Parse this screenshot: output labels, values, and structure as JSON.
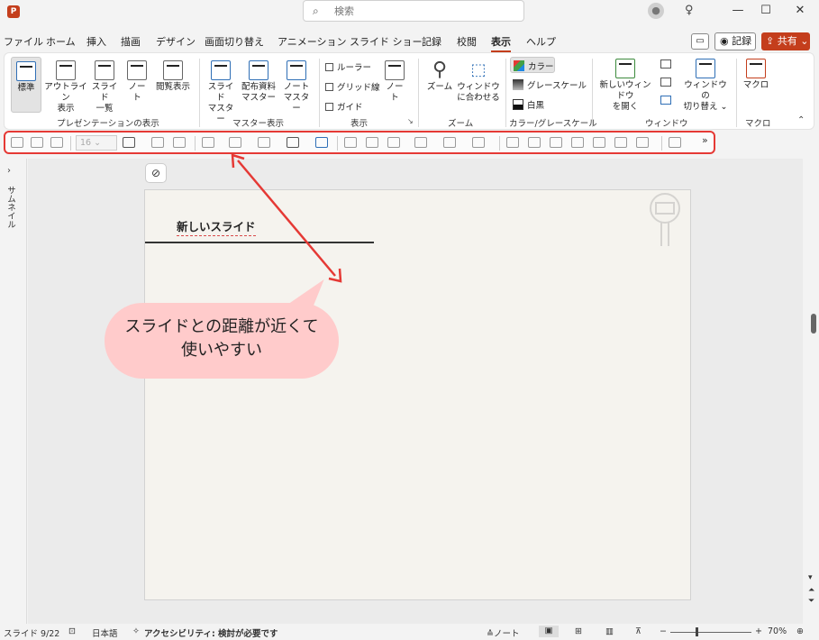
{
  "titlebar": {
    "app_icon": "P",
    "search_placeholder": "検索",
    "icons": [
      "user-icon",
      "lightbulb-icon",
      "minimize-icon",
      "maximize-icon",
      "close-icon"
    ],
    "min": "—",
    "max": "☐",
    "close": "✕"
  },
  "menu": {
    "tabs": [
      "ファイル",
      "ホーム",
      "挿入",
      "描画",
      "デザイン",
      "画面切り替え",
      "アニメーション",
      "スライド ショー",
      "記録",
      "校閲",
      "表示",
      "ヘルプ"
    ],
    "active_tab": "表示",
    "record_label": "記録",
    "share_label": "共有"
  },
  "ribbon": {
    "presentation_views": {
      "label": "プレゼンテーションの表示",
      "normal": "標準",
      "outline_1": "アウトライン",
      "outline_2": "表示",
      "sorter_1": "スライド",
      "sorter_2": "一覧",
      "notes_1": "ノー",
      "notes_2": "ト",
      "reading": "閲覧表示"
    },
    "master_views": {
      "label": "マスター表示",
      "slide_1": "スライド",
      "slide_2": "マスター",
      "handout_1": "配布資料",
      "handout_2": "マスター",
      "notes_1": "ノート",
      "notes_2": "マスター"
    },
    "show": {
      "label": "表示",
      "ruler": "ルーラー",
      "grid": "グリッド線",
      "guide": "ガイド",
      "notes_1": "ノー",
      "notes_2": "ト"
    },
    "zoom": {
      "label": "ズーム",
      "zoom": "ズーム",
      "fit_1": "ウィンドウ",
      "fit_2": "に合わせる"
    },
    "color": {
      "label": "カラー/グレースケール",
      "color": "カラー",
      "grayscale": "グレースケール",
      "bw": "白黒"
    },
    "window": {
      "label": "ウィンドウ",
      "new_1": "新しいウィンドウ",
      "new_2": "を開く",
      "switch_1": "ウィンドウの",
      "switch_2": "切り替え ⌄"
    },
    "macros": {
      "label": "マクロ",
      "macro": "マクロ"
    }
  },
  "qat": {
    "font_size": "16",
    "more": "»"
  },
  "sidebar": {
    "label": "サムネイル",
    "chevron": "›"
  },
  "slide": {
    "title": "新しいスライド"
  },
  "callout": {
    "line1": "スライドとの距離が近くて",
    "line2": "使いやすい"
  },
  "status": {
    "slide_counter": "スライド 9/22",
    "language": "日本語",
    "accessibility": "アクセシビリティ: 検討が必要です",
    "notes": "ノート",
    "zoom_minus": "−",
    "zoom_plus": "+",
    "zoom_level": "70%"
  },
  "colors": {
    "accent": "#c43e1c",
    "highlight_box": "#e53935",
    "callout": "#ffcbcb",
    "arrow": "#e53935"
  }
}
